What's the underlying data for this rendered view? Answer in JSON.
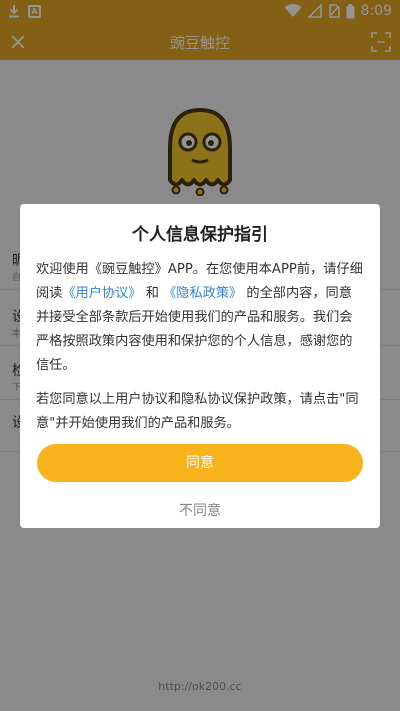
{
  "status_bar": {
    "time": "8:09",
    "icons": [
      "download-icon",
      "notification-icon",
      "wifi-icon",
      "signal-icon",
      "no-sim-icon",
      "battery-icon"
    ]
  },
  "toolbar": {
    "title": "豌豆触控"
  },
  "background_list": [
    {
      "title": "昵",
      "subtitle": "自"
    },
    {
      "title": "设",
      "subtitle": "本"
    },
    {
      "title": "检",
      "subtitle": "下"
    },
    {
      "title": "设",
      "subtitle": ""
    }
  ],
  "footer": {
    "url": "http://ok200.cc"
  },
  "dialog": {
    "title": "个人信息保护指引",
    "p1_part1": "欢迎使用《豌豆触控》APP。在您使用本APP前，请仔细阅读",
    "link_user_agreement": "《用户协议》",
    "p1_and": "和",
    "link_privacy_policy": "《隐私政策》",
    "p1_part2": "的全部内容，同意并接受全部条款后开始使用我们的产品和服务。我们会严格按照政策内容使用和保护您的个人信息，感谢您的信任。",
    "p2": "若您同意以上用户协议和隐私协议保护政策，请点击\"同意\"并开始使用我们的产品和服务。",
    "agree_label": "同意",
    "disagree_label": "不同意"
  },
  "colors": {
    "primary": "#e2a523",
    "button": "#f7b21c",
    "link": "#2d86e0"
  }
}
